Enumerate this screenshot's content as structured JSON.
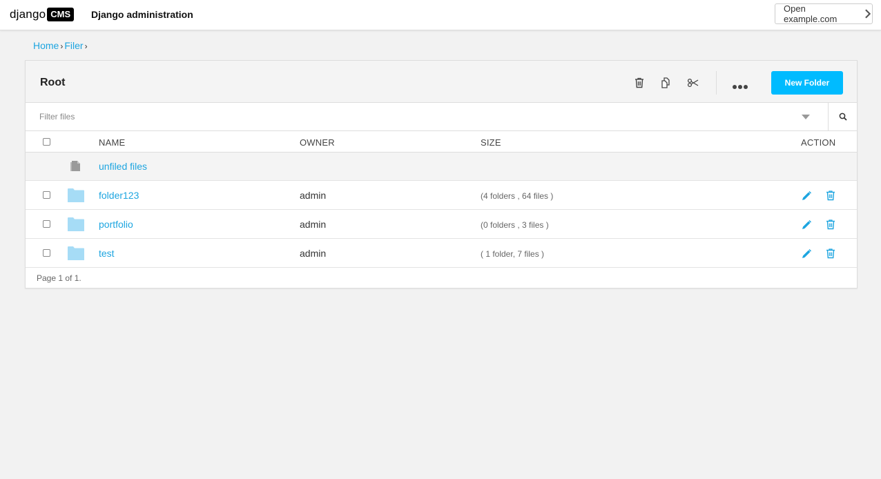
{
  "brand": {
    "django": "django",
    "cms": "CMS"
  },
  "header": {
    "site_title": "Django administration",
    "open_site_label": "Open example.com"
  },
  "breadcrumb": {
    "home": "Home",
    "sep": "›",
    "filer": "Filer"
  },
  "panel": {
    "title": "Root",
    "new_folder_label": "New Folder"
  },
  "filter": {
    "placeholder": "Filter files",
    "value": ""
  },
  "table": {
    "headers": {
      "name": "NAME",
      "owner": "OWNER",
      "size": "SIZE",
      "action": "ACTION"
    },
    "unfiled": {
      "name": "unfiled files"
    },
    "rows": [
      {
        "name": "folder123",
        "owner": "admin",
        "size": "(4 folders , 64 files )"
      },
      {
        "name": "portfolio",
        "owner": "admin",
        "size": "(0 folders , 3 files )"
      },
      {
        "name": "test",
        "owner": "admin",
        "size": "( 1 folder, 7 files )"
      }
    ]
  },
  "footer": {
    "pagination": "Page 1 of 1."
  },
  "colors": {
    "accent": "#00bbff",
    "link": "#1da5e0",
    "folder": "#a6dcf6"
  },
  "icons": {
    "toolbar": [
      "delete-icon",
      "copy-icon",
      "cut-icon",
      "more-icon"
    ],
    "row_actions": [
      "edit-icon",
      "delete-icon"
    ],
    "search": "search-icon"
  }
}
